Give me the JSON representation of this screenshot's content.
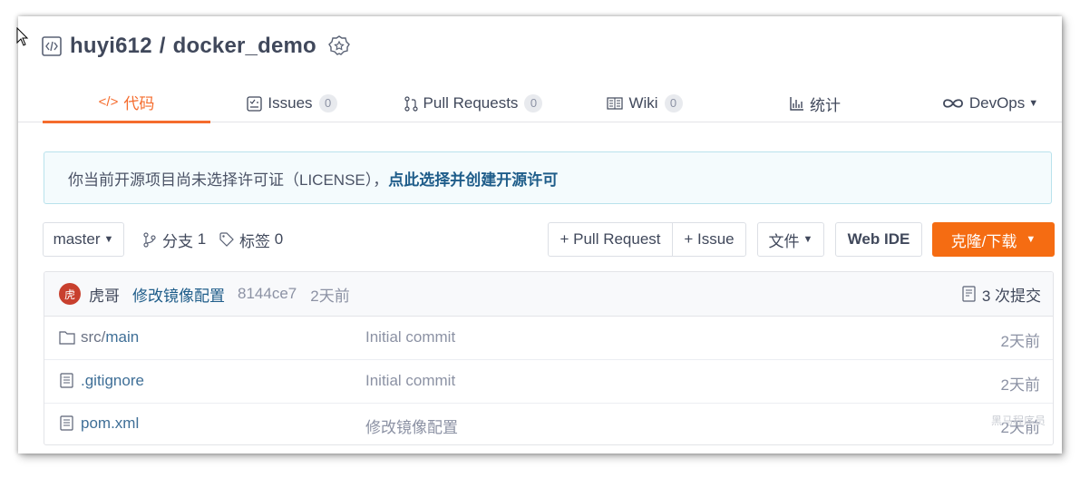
{
  "repo": {
    "owner": "huyi612",
    "separator": "/",
    "name": "docker_demo"
  },
  "tabs": [
    {
      "label": "代码",
      "icon": "code-icon",
      "active": true
    },
    {
      "label": "Issues",
      "count": "0",
      "icon": "issues-icon"
    },
    {
      "label": "Pull Requests",
      "count": "0",
      "icon": "pull-request-icon"
    },
    {
      "label": "Wiki",
      "count": "0",
      "icon": "wiki-icon"
    },
    {
      "label": "统计",
      "icon": "stats-icon"
    },
    {
      "label": "DevOps",
      "icon": "infinity-icon",
      "dropdown": true
    }
  ],
  "banner": {
    "text": "你当前开源项目尚未选择许可证（LICENSE），",
    "link": "点此选择并创建开源许可"
  },
  "toolbar": {
    "branch": "master",
    "branches_label": "分支",
    "branches_count": "1",
    "tags_label": "标签",
    "tags_count": "0",
    "pull_request": "+ Pull Request",
    "issue": "+ Issue",
    "files": "文件",
    "web_ide": "Web IDE",
    "clone": "克隆/下载"
  },
  "last_commit": {
    "avatar_char": "虎",
    "author": "虎哥",
    "message": "修改镜像配置",
    "hash": "8144ce7",
    "time": "2天前",
    "commit_count_label": "3 次提交"
  },
  "files": [
    {
      "type": "folder",
      "prefix": "src/",
      "name": "main",
      "message": "Initial commit",
      "time": "2天前"
    },
    {
      "type": "file",
      "prefix": "",
      "name": ".gitignore",
      "message": "Initial commit",
      "time": "2天前"
    },
    {
      "type": "file",
      "prefix": "",
      "name": "pom.xml",
      "message": "修改镜像配置",
      "time": "2天前"
    }
  ],
  "watermark": "黑马程序员",
  "colors": {
    "accent": "#f56c2d",
    "clone_button": "#f56c12",
    "link": "#1f5d8a",
    "banner_bg": "#f4fbfd",
    "avatar_bg": "#c8402e"
  }
}
